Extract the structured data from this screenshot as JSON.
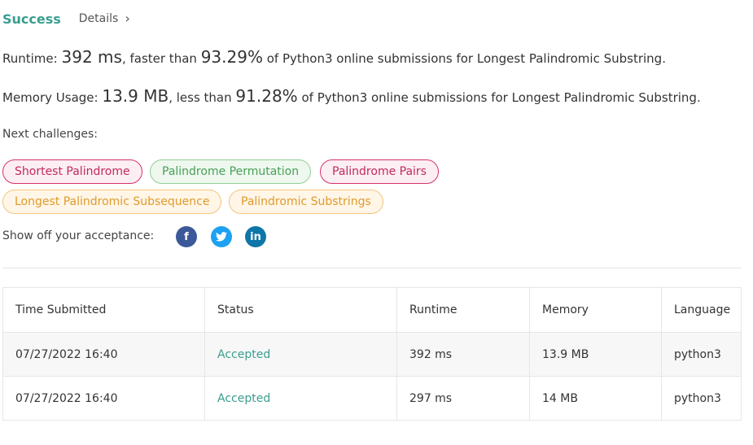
{
  "header": {
    "status": "Success",
    "details": "Details",
    "colors": {
      "success": "#3a9e8f"
    }
  },
  "runtime": {
    "label": "Runtime:",
    "value": "392 ms",
    "mid": ", faster than",
    "percent": "93.29%",
    "suffix": "of Python3 online submissions for Longest Palindromic Substring."
  },
  "memory": {
    "label": "Memory Usage:",
    "value": "13.9 MB",
    "mid": ", less than",
    "percent": "91.28%",
    "suffix": "of Python3 online submissions for Longest Palindromic Substring."
  },
  "next": {
    "label": "Next challenges:",
    "items": [
      {
        "label": "Shortest Palindrome",
        "difficulty": "hard"
      },
      {
        "label": "Palindrome Permutation",
        "difficulty": "easy"
      },
      {
        "label": "Palindrome Pairs",
        "difficulty": "hard"
      },
      {
        "label": "Longest Palindromic Subsequence",
        "difficulty": "medium"
      },
      {
        "label": "Palindromic Substrings",
        "difficulty": "medium"
      }
    ]
  },
  "share": {
    "label": "Show off your acceptance:",
    "icons": [
      {
        "name": "facebook-icon",
        "glyph": "f",
        "color": "#3b5998"
      },
      {
        "name": "twitter-icon",
        "glyph": "t",
        "color": "#1da1f2"
      },
      {
        "name": "linkedin-icon",
        "glyph": "in",
        "color": "#0e76a8"
      }
    ]
  },
  "table": {
    "headers": [
      "Time Submitted",
      "Status",
      "Runtime",
      "Memory",
      "Language"
    ],
    "rows": [
      [
        "07/27/2022 16:40",
        "Accepted",
        "392 ms",
        "13.9 MB",
        "python3"
      ],
      [
        "07/27/2022 16:40",
        "Accepted",
        "297 ms",
        "14 MB",
        "python3"
      ]
    ]
  }
}
